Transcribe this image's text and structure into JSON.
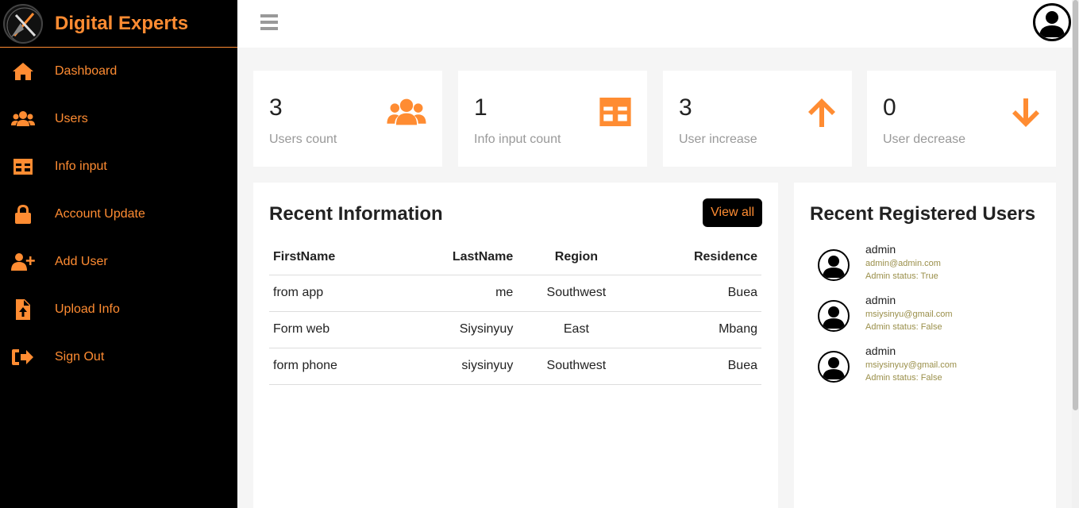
{
  "brand": {
    "name": "Digital Experts"
  },
  "sidebar": {
    "items": [
      {
        "label": "Dashboard",
        "icon": "home-icon"
      },
      {
        "label": "Users",
        "icon": "users-icon"
      },
      {
        "label": "Info input",
        "icon": "table-icon"
      },
      {
        "label": "Account Update",
        "icon": "lock-icon"
      },
      {
        "label": "Add User",
        "icon": "user-plus-icon"
      },
      {
        "label": "Upload Info",
        "icon": "file-upload-icon"
      },
      {
        "label": "Sign Out",
        "icon": "sign-out-icon"
      }
    ]
  },
  "cards": [
    {
      "value": "3",
      "label": "Users count",
      "icon": "users-icon"
    },
    {
      "value": "1",
      "label": "Info input count",
      "icon": "table-icon"
    },
    {
      "value": "3",
      "label": "User increase",
      "icon": "arrow-up-icon"
    },
    {
      "value": "0",
      "label": "User decrease",
      "icon": "arrow-down-icon"
    }
  ],
  "recent_info": {
    "title": "Recent Information",
    "view_all_label": "View all",
    "columns": [
      "FirstName",
      "LastName",
      "Region",
      "Residence"
    ],
    "rows": [
      [
        "from app",
        "me",
        "Southwest",
        "Buea"
      ],
      [
        "Form web",
        "Siysinyuy",
        "East",
        "Mbang"
      ],
      [
        "form phone",
        "siysinyuy",
        "Southwest",
        "Buea"
      ]
    ]
  },
  "recent_users": {
    "title": "Recent Registered Users",
    "users": [
      {
        "name": "admin",
        "email": "admin@admin.com",
        "status": "Admin status: True"
      },
      {
        "name": "admin",
        "email": "msiysinyu@gmail.com",
        "status": "Admin status: False"
      },
      {
        "name": "admin",
        "email": "msiysinyuy@gmail.com",
        "status": "Admin status: False"
      }
    ]
  },
  "colors": {
    "accent": "#ff8c32",
    "sidebar_bg": "#000000",
    "page_bg": "#f5f5f5"
  }
}
